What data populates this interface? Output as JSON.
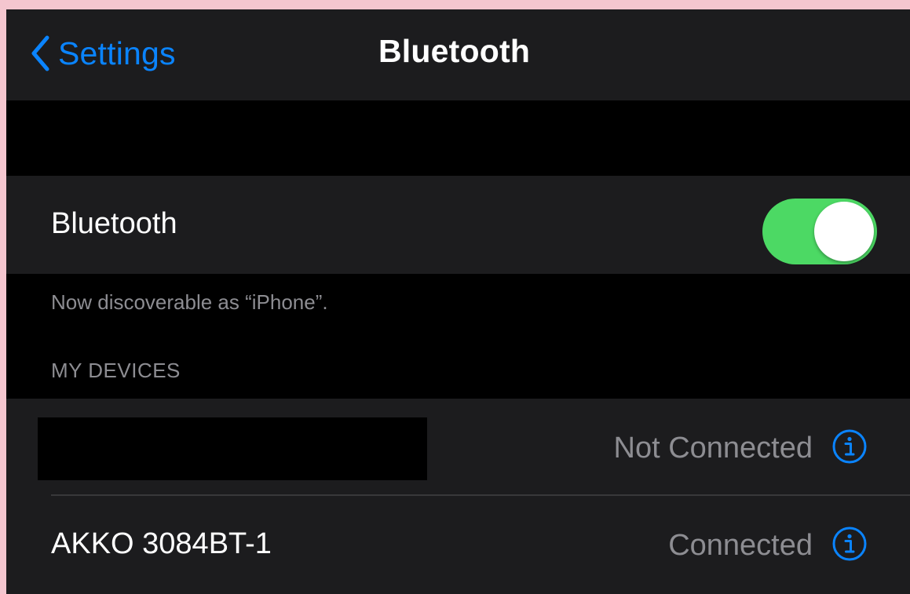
{
  "colors": {
    "accent": "#0a84ff",
    "toggle_on": "#4cd964",
    "background": "#000000",
    "cell": "#1c1c1e",
    "secondary_text": "#8d8d92"
  },
  "nav": {
    "back_label": "Settings",
    "back_icon": "chevron-left-icon",
    "title": "Bluetooth"
  },
  "bluetooth": {
    "label": "Bluetooth",
    "enabled": true,
    "footer": "Now discoverable as “iPhone”."
  },
  "devices": {
    "header": "MY DEVICES",
    "items": [
      {
        "name": "",
        "redacted": true,
        "status": "Not Connected",
        "info_icon": "info-icon"
      },
      {
        "name": "AKKO 3084BT-1",
        "redacted": false,
        "status": "Connected",
        "info_icon": "info-icon"
      }
    ]
  }
}
